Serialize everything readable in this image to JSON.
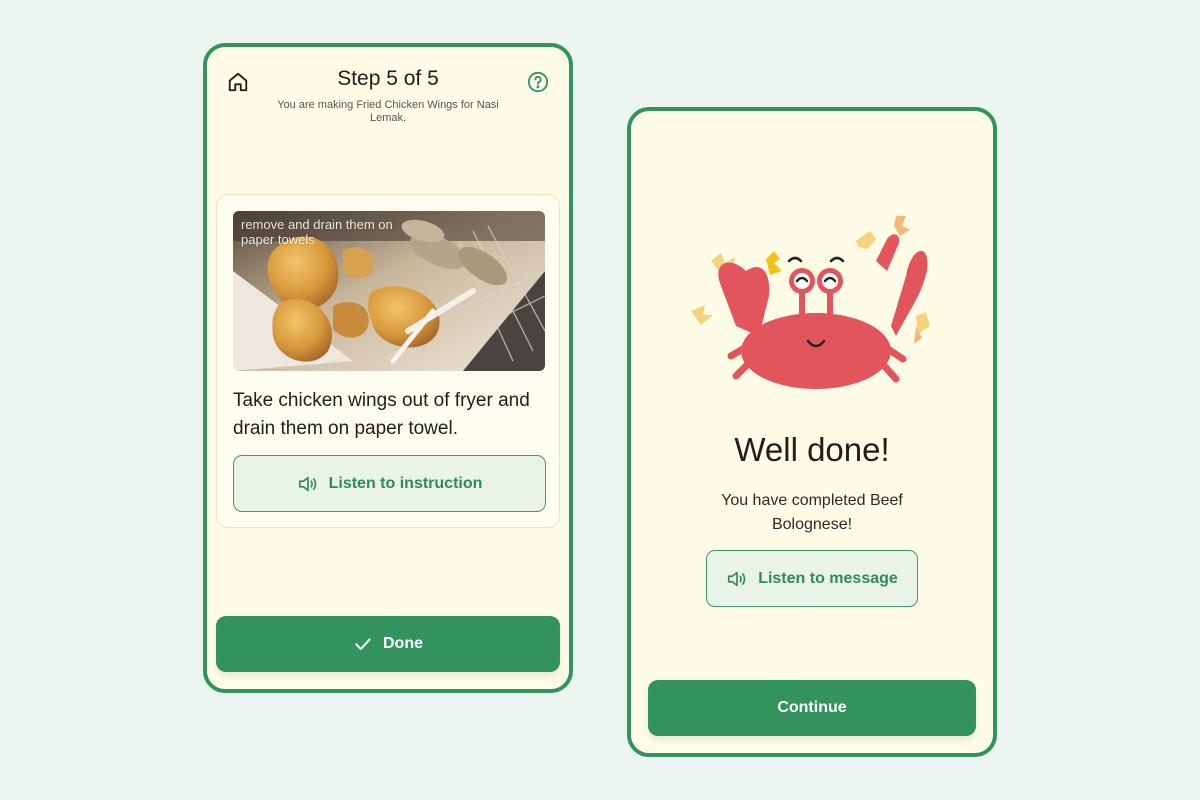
{
  "step_screen": {
    "title": "Step 5 of 5",
    "subtitle": "You are making Fried Chicken Wings for Nasi Lemak.",
    "photo_caption": "remove and drain them on paper towels",
    "instruction": "Take chicken wings out of fryer and drain them on paper towel.",
    "listen_label": "Listen to instruction",
    "done_label": "Done",
    "icons": {
      "home": "home-icon",
      "help": "help-icon",
      "speaker": "speaker-icon",
      "check": "check-icon"
    }
  },
  "done_screen": {
    "heading": "Well done!",
    "message": "You have completed Beef Bolognese!",
    "listen_label": "Listen to message",
    "continue_label": "Continue",
    "illustration": "celebrating-crab"
  },
  "colors": {
    "brand_green": "#33935f",
    "screen_bg": "#fefbe7",
    "page_bg": "#ebf4ee",
    "crab_red": "#e2555b"
  }
}
